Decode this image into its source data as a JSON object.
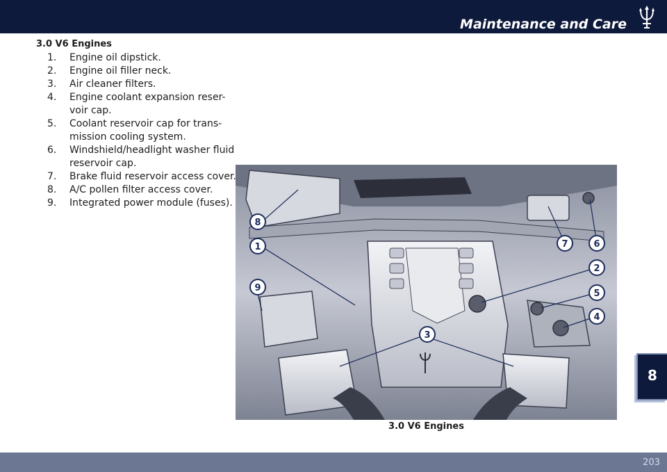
{
  "header": {
    "section_title": "Maintenance and Care",
    "logo_icon": "trident-logo-icon"
  },
  "content": {
    "heading": "3.0 V6 Engines",
    "items": [
      {
        "num": "1.",
        "text": "Engine oil dipstick."
      },
      {
        "num": "2.",
        "text": "Engine oil filler neck."
      },
      {
        "num": "3.",
        "text": "Air cleaner filters."
      },
      {
        "num": "4.",
        "text": "Engine coolant expansion reser-voir cap."
      },
      {
        "num": "5.",
        "text": "Coolant reservoir cap for trans-mission cooling system."
      },
      {
        "num": "6.",
        "text": "Windshield/headlight washer fluid reservoir cap."
      },
      {
        "num": "7.",
        "text": "Brake fluid reservoir access cover."
      },
      {
        "num": "8.",
        "text": "A/C pollen filter access cover."
      },
      {
        "num": "9.",
        "text": "Integrated power module (fuses)."
      }
    ]
  },
  "figure": {
    "callouts": [
      "8",
      "1",
      "9",
      "3",
      "7",
      "6",
      "2",
      "5",
      "4"
    ],
    "caption": "3.0 V6 Engines"
  },
  "chapter_tab": {
    "number": "8"
  },
  "footer": {
    "page_number": "203"
  },
  "colors": {
    "navy": "#0e1a3c",
    "footer": "#6c7794",
    "figure_bg": "#c9ccd6"
  }
}
